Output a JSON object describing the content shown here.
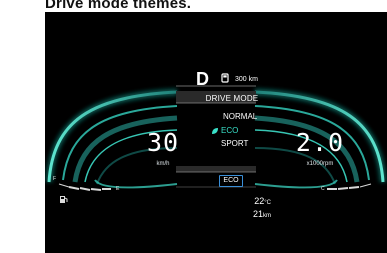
{
  "heading": "Drive mode themes.",
  "cluster": {
    "gear": "D",
    "range": "300 km",
    "speed": {
      "value": "30",
      "unit": "km/h"
    },
    "rpm": {
      "value": "2.0",
      "unit": "x1000rpm"
    },
    "drive_mode_menu": {
      "title": "DRIVE MODE",
      "options": [
        "NORMAL",
        "ECO",
        "SPORT"
      ],
      "selected": "ECO"
    },
    "active_mode_badge": "ECO",
    "temperature": {
      "value": "22",
      "unit": "°C"
    },
    "odometer": {
      "value": "21",
      "unit": "km"
    },
    "fuel_gauge": {
      "full_label": "F",
      "empty_label": "E"
    },
    "temp_gauge": {
      "cold_label": "C"
    },
    "colors": {
      "background": "#000000",
      "ring_teal": "#37c6b4",
      "ring_glow": "#0d6a63",
      "eco_accent": "#39e0c8",
      "badge_border": "#3a8fd8",
      "text": "#ffffff"
    },
    "icons": {
      "fuel_range": "fuel-can-icon",
      "eco": "leaf-icon",
      "fuel_gauge": "fuel-pump-icon"
    }
  }
}
